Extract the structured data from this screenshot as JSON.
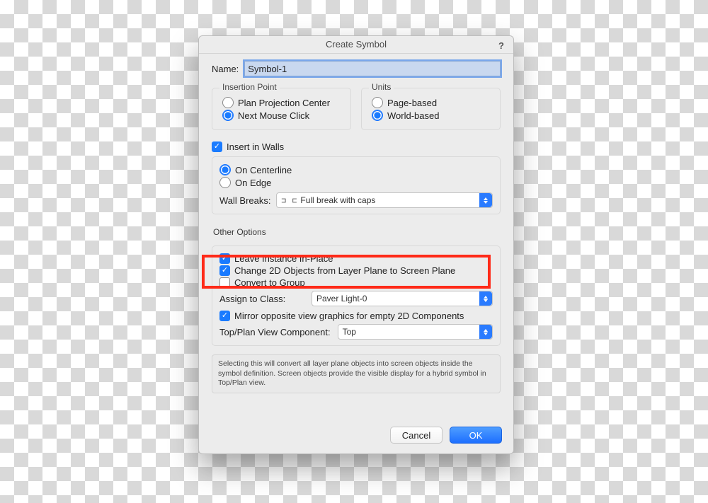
{
  "dialog": {
    "title": "Create Symbol",
    "help": "?",
    "name_label": "Name:",
    "name_value": "Symbol-1",
    "insertion_point": {
      "legend": "Insertion Point",
      "opt_plan": "Plan Projection Center",
      "opt_mouse": "Next Mouse Click"
    },
    "units": {
      "legend": "Units",
      "opt_page": "Page-based",
      "opt_world": "World-based"
    },
    "insert_walls": {
      "checkbox": "Insert in Walls",
      "opt_center": "On Centerline",
      "opt_edge": "On Edge",
      "wall_breaks_label": "Wall Breaks:",
      "wall_breaks_value": "Full break with caps"
    },
    "other_options": {
      "label": "Other Options",
      "leave_instance": "Leave Instance In-Place",
      "change_2d": "Change 2D Objects from Layer Plane to Screen Plane",
      "convert_group": "Convert to Group",
      "assign_class_label": "Assign to Class:",
      "assign_class_value": "Paver Light-0",
      "mirror": "Mirror opposite view graphics for empty 2D Components",
      "top_plan_label": "Top/Plan View Component:",
      "top_plan_value": "Top"
    },
    "hint": "Selecting this will convert all layer plane objects into screen objects inside the symbol definition.  Screen objects provide the visible display for a hybrid symbol in Top/Plan view.",
    "buttons": {
      "cancel": "Cancel",
      "ok": "OK"
    }
  }
}
